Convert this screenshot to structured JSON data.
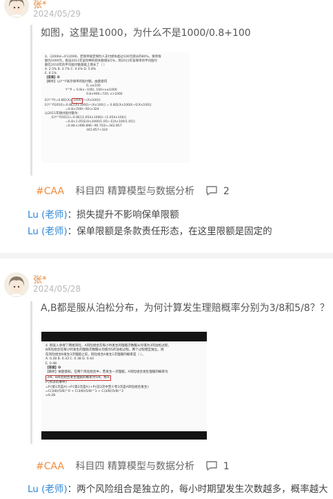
{
  "posts": [
    {
      "user": "张*",
      "date": "2024/05/29",
      "question": "如图，这里是1000，为什么不是1000/0.8+100",
      "image_lines": [
        "4、(2000d=d²)/2000，若保单规定保险人支付损失超过100元部分的80%，保单限",
        "额为1000元，假设2011年该险种的损失额增长5%，到2011年该保单的平均赔付",
        "额在2010年的平均赔付额基础上增长了（    ）",
        "A. 2.5%      B. 3.7%      C. 4.4%      D. 5.8%",
        "E. 6.1%",
        "【答案】D",
        "【解析】以Y^P表示保单的赔付额，由题意得",
        "0,                       x≤100",
        "Y^P =   0.8(x−100),     100<x≤1000",
        "0.8×900=720,   x>1000",
        "E(Y^P2010)=0.8E[(X∧1000)−(X∧100)] = 0.8[E(X∧1000)−E(X∧100)]",
        "=0.8×(500−92)×324",
        "以2011年随付赔付额为：",
        "E(Y^P2011)=0.8E[(1.05X∧1000)−(1.05X∧100)]",
        "=0.8×1.05[E(X∧1000/1.05)−E(X∧100/1.05)]",
        "=0.84×(498.896−90.703)=342.857",
        "342.857÷324"
      ],
      "box_text": "1000",
      "tag": "#CAA",
      "category": "科目四 精算模型与数据分析",
      "comment_count": "2",
      "replies": [
        {
          "name": "Lu (老师)",
          "sep": "：",
          "text": "损失提升不影响保单限额"
        },
        {
          "name": "Lu (老师)",
          "sep": "：",
          "text": "保单限额是条款责任形态，在这里限额是固定的"
        }
      ]
    },
    {
      "user": "张*",
      "date": "2024/05/28",
      "question": "A,B都是服从泊松分布，为何计算发生理赔概率分别为3/8和5/8？？",
      "image_lines": [
        "4. 假设入承保了两组风险，A风险组合在每小时发生的理赔次数服从均值为3的泊松过程，",
        "B风险组合在每小时发生的理赔次数服从均值为5的泊松过程。两个过程相互独立。则",
        "在风险组合B发生3次理赔之前，风险组合A发生1次理赔的概率是（        ）。",
        "A. 0.28         B. 0.33         C. 0.38         D. 0.43",
        "E. 0.48",
        "【答案】D",
        "【解析】依题意知，在两个风险组合中，若发生一次理赔，A风险组合发生理赔的概率为",
        "3/8，B风险组合发生理赔的概率为5/8，那么",
        "P{所求的事件}",
        "=P{第1次是A}+P{第2次是A}+P{前3次中至少有3次是A风险组合发生}",
        "=C(3/8)(5/8)^0 + C(3/8)(5/8)^1 + C(3/8)(5/8)^2",
        "≈0.28"
      ],
      "tag": "#CAA",
      "category": "科目四 精算模型与数据分析",
      "comment_count": "1",
      "replies": [
        {
          "name": "Lu (老师)",
          "sep": "：",
          "text": "两个风险组合是独立的，每小时期望发生次数越多，概率越大"
        }
      ]
    }
  ],
  "colors": {
    "username": "#e08a3c",
    "tag": "#f08c3c",
    "teacher": "#2f86d6",
    "date": "#b8b8b8"
  },
  "icons": {
    "avatar": "anime-avatar-icon",
    "comment": "comment-bubble-icon"
  }
}
